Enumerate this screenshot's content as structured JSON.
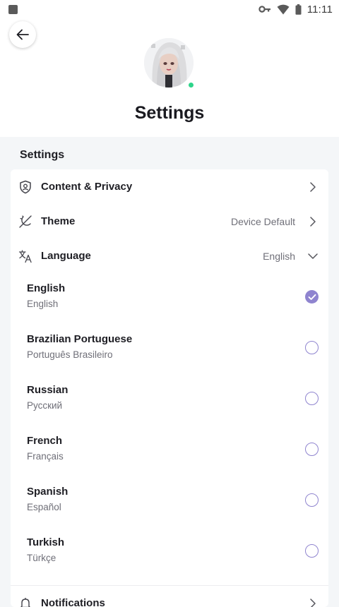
{
  "status_bar": {
    "time": "11:11",
    "icons": [
      "app-square-icon",
      "key-icon",
      "wifi-icon",
      "battery-icon"
    ]
  },
  "header": {
    "back_icon": "arrow-left-icon",
    "title": "Settings",
    "online_color": "#2ed48a"
  },
  "settings": {
    "section_title": "Settings",
    "rows": {
      "content_privacy": {
        "label": "Content & Privacy",
        "icon": "shield-user-icon"
      },
      "theme": {
        "label": "Theme",
        "value": "Device Default",
        "icon": "theme-icon"
      },
      "language": {
        "label": "Language",
        "value": "English",
        "icon": "translate-icon"
      },
      "notifications": {
        "label": "Notifications",
        "icon": "bell-icon"
      }
    },
    "languages": [
      {
        "name": "English",
        "native": "English",
        "selected": true
      },
      {
        "name": "Brazilian Portuguese",
        "native": "Português Brasileiro",
        "selected": false
      },
      {
        "name": "Russian",
        "native": "Русский",
        "selected": false
      },
      {
        "name": "French",
        "native": "Français",
        "selected": false
      },
      {
        "name": "Spanish",
        "native": "Español",
        "selected": false
      },
      {
        "name": "Turkish",
        "native": "Türkçe",
        "selected": false
      }
    ],
    "accent_color": "#8f84cf"
  }
}
